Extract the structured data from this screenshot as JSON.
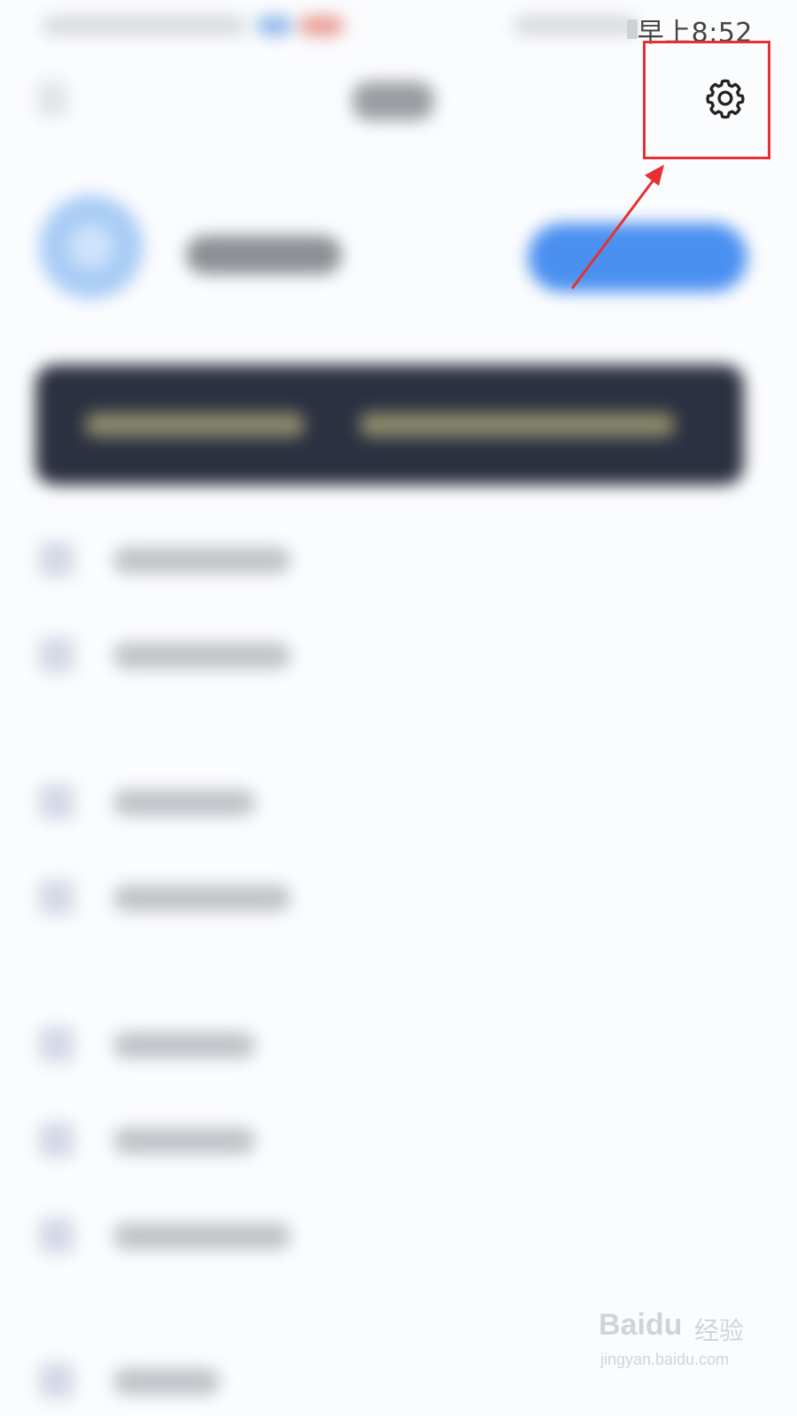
{
  "status_bar": {
    "time": "早上8:52"
  },
  "toolbar": {
    "settings_icon": "gear-icon"
  },
  "annotation": {
    "highlight_color": "#e53131"
  },
  "watermark": {
    "brand": "Baidu",
    "brand_cn": "经验",
    "url": "jingyan.baidu.com"
  }
}
